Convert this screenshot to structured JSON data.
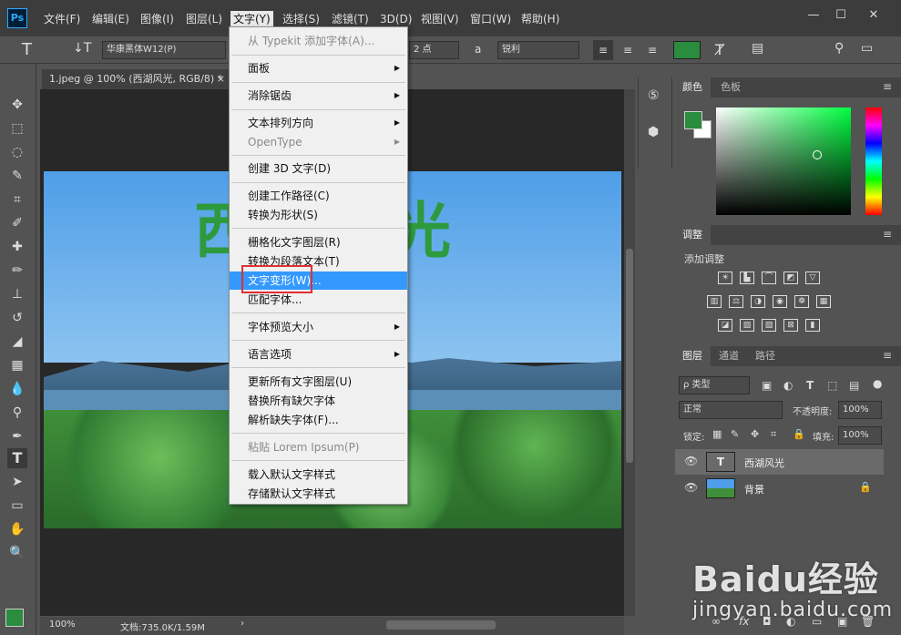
{
  "menubar": {
    "logo": "Ps",
    "items": [
      "文件(F)",
      "编辑(E)",
      "图像(I)",
      "图层(L)",
      "文字(Y)",
      "选择(S)",
      "滤镜(T)",
      "3D(D)",
      "视图(V)",
      "窗口(W)",
      "帮助(H)"
    ],
    "window_buttons": [
      "—",
      "☐",
      "✕"
    ]
  },
  "options": {
    "tool_glyph": "T",
    "font_family": "华康黑体W12(P)",
    "font_size": "2 点",
    "aa_icon": "a",
    "aa": "锐利"
  },
  "document": {
    "tab_title": "1.jpeg @ 100% (西湖风光, RGB/8) *",
    "close": "×",
    "canvas_text": "西湖风光"
  },
  "type_menu": {
    "items": [
      {
        "label": "从 Typekit 添加字体(A)...",
        "disabled": true
      },
      {
        "label": "面板",
        "submenu": true
      },
      {
        "label": "消除锯齿",
        "submenu": true
      },
      {
        "label": "文本排列方向",
        "submenu": true
      },
      {
        "label": "OpenType",
        "submenu": true,
        "disabled": true
      },
      {
        "label": "创建 3D 文字(D)"
      },
      {
        "label": "创建工作路径(C)"
      },
      {
        "label": "转换为形状(S)"
      },
      {
        "label": "栅格化文字图层(R)"
      },
      {
        "label": "转换为段落文本(T)"
      },
      {
        "label": "文字变形(W)...",
        "highlighted": true
      },
      {
        "label": "匹配字体..."
      },
      {
        "label": "字体预览大小",
        "submenu": true
      },
      {
        "label": "语言选项",
        "submenu": true
      },
      {
        "label": "更新所有文字图层(U)"
      },
      {
        "label": "替换所有缺欠字体"
      },
      {
        "label": "解析缺失字体(F)..."
      },
      {
        "label": "粘贴 Lorem Ipsum(P)",
        "disabled": true
      },
      {
        "label": "载入默认文字样式"
      },
      {
        "label": "存储默认文字样式"
      }
    ]
  },
  "panels": {
    "color_tabs": [
      "颜色",
      "色板"
    ],
    "adjust_tab": "调整",
    "adjust_title": "添加调整",
    "layer_tabs": [
      "图层",
      "通道",
      "路径"
    ],
    "filter_label": "ρ 类型",
    "blend_mode": "正常",
    "opacity_label": "不透明度:",
    "opacity": "100%",
    "lock_label": "锁定:",
    "fill_label": "填充:",
    "fill": "100%",
    "layers": [
      {
        "name": "西湖风光",
        "type": "text"
      },
      {
        "name": "背景",
        "type": "image",
        "locked": true
      }
    ],
    "bottom_icons": [
      "∞",
      "fx",
      "◘",
      "◐",
      "▭",
      "▣",
      "🗑"
    ]
  },
  "status": {
    "zoom": "100%",
    "doc_info": "文档:735.0K/1.59M"
  },
  "watermark": {
    "brand": "Baidu经验",
    "url": "jingyan.baidu.com"
  },
  "colors": {
    "foreground": "#2a8c3e",
    "highlight": "#3399ff",
    "menu_red_box": "#e03030"
  }
}
